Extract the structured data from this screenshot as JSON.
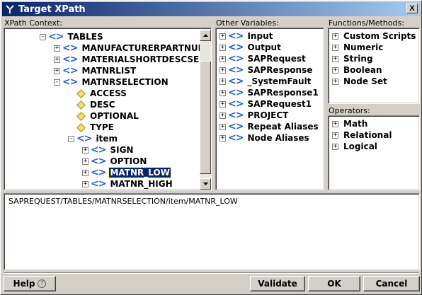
{
  "window": {
    "title": "Target XPath"
  },
  "xpath_context": {
    "label": "XPath Context:",
    "rows": [
      {
        "label": "TABLES",
        "icon": "node",
        "expander": "-"
      },
      {
        "label": "MANUFACTURERPARTNUMB",
        "icon": "node",
        "expander": "+"
      },
      {
        "label": "MATERIALSHORTDESCSEL",
        "icon": "node",
        "expander": "+"
      },
      {
        "label": "MATNRLIST",
        "icon": "node",
        "expander": "+"
      },
      {
        "label": "MATNRSELECTION",
        "icon": "node",
        "expander": "-"
      },
      {
        "label": "ACCESS",
        "icon": "leaf",
        "expander": ""
      },
      {
        "label": "DESC",
        "icon": "leaf",
        "expander": ""
      },
      {
        "label": "OPTIONAL",
        "icon": "leaf",
        "expander": ""
      },
      {
        "label": "TYPE",
        "icon": "leaf",
        "expander": ""
      },
      {
        "label": "item",
        "icon": "node",
        "expander": "-"
      },
      {
        "label": "SIGN",
        "icon": "node",
        "expander": "+"
      },
      {
        "label": "OPTION",
        "icon": "node",
        "expander": "+"
      },
      {
        "label": "MATNR_LOW",
        "icon": "node",
        "expander": "+",
        "selected": true
      },
      {
        "label": "MATNR_HIGH",
        "icon": "node",
        "expander": "+"
      }
    ]
  },
  "other_variables": {
    "label": "Other Variables:",
    "items": [
      "Input",
      "Output",
      "SAPRequest",
      "SAPResponse",
      "_SystemFault",
      "SAPResponse1",
      "SAPRequest1",
      "PROJECT",
      "Repeat Aliases",
      "Node Aliases"
    ]
  },
  "functions": {
    "label": "Functions/Methods:",
    "items": [
      "Custom Scripts",
      "Numeric",
      "String",
      "Boolean",
      "Node Set"
    ]
  },
  "operators": {
    "label": "Operators:",
    "items": [
      "Math",
      "Relational",
      "Logical"
    ]
  },
  "xpath_expression": "SAPREQUEST/TABLES/MATNRSELECTION/item/MATNR_LOW",
  "buttons": {
    "help": "Help",
    "help_glyph": "?",
    "validate": "Validate",
    "ok": "OK",
    "cancel": "Cancel",
    "close_glyph": "X"
  },
  "colors": {
    "titlebar": "#0a246a",
    "node_icon": "#1f5fd0",
    "selection": "#0a246a"
  },
  "icons": {
    "app": "xpath-wand-icon",
    "node": "element-node-icon",
    "leaf": "attribute-diamond-icon",
    "expand": "plus-box-icon",
    "collapse": "minus-box-icon"
  }
}
